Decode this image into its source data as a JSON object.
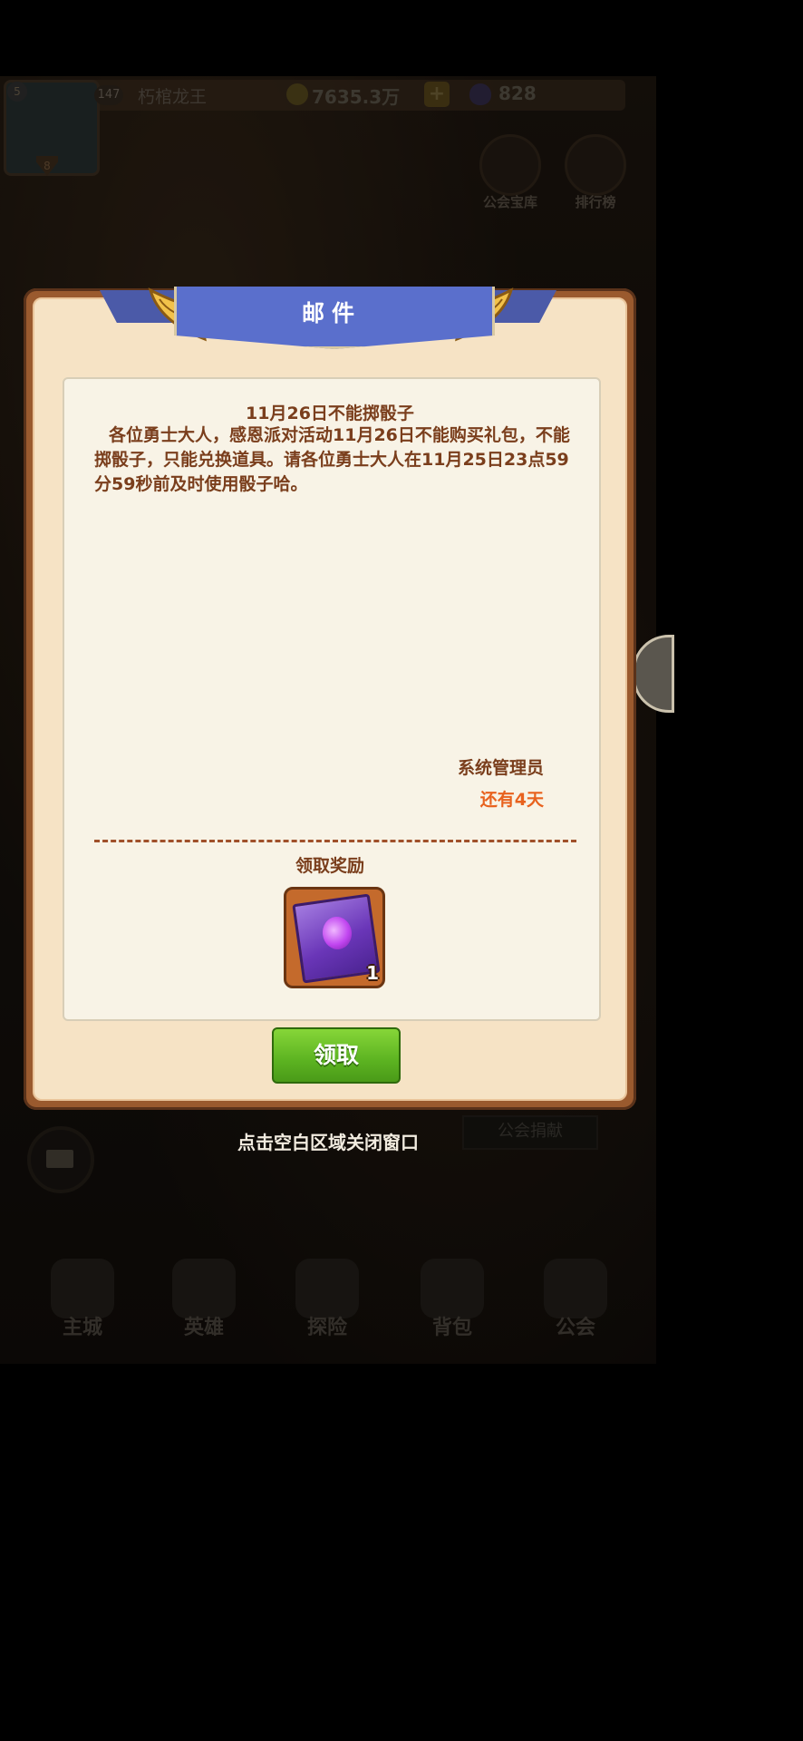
{
  "top_bar": {
    "avatar_level": "5",
    "avatar_rank": "8",
    "player_level": "147",
    "player_name": "朽棺龙王",
    "gold": "7635.3万",
    "plus_label": "+",
    "gems": "828"
  },
  "side_buttons": {
    "guild_vault": "公会宝库",
    "leaderboard": "排行榜"
  },
  "dialog": {
    "title": "邮件",
    "mail_title": "11月26日不能掷骰子",
    "mail_body": "各位勇士大人，感恩派对活动11月26日不能购买礼包，不能掷骰子，只能兑换道具。请各位勇士大人在11月25日23点59分59秒前及时使用骰子哈。",
    "sender": "系统管理员",
    "expiry": "还有4天",
    "reward_label": "领取奖励",
    "reward_quantity": "1",
    "claim_button": "领取"
  },
  "close_hint": "点击空白区域关闭窗口",
  "guild_donate": "公会捐献",
  "bottom_nav": {
    "items": [
      {
        "label": "主城"
      },
      {
        "label": "英雄"
      },
      {
        "label": "探险"
      },
      {
        "label": "背包"
      },
      {
        "label": "公会"
      }
    ]
  },
  "colors": {
    "dialog_frame": "#9a5a2e",
    "banner_blue": "#5a6fcc",
    "text_brown": "#7a3e1c",
    "expiry_orange": "#e8621e",
    "claim_green": "#5cb321"
  }
}
